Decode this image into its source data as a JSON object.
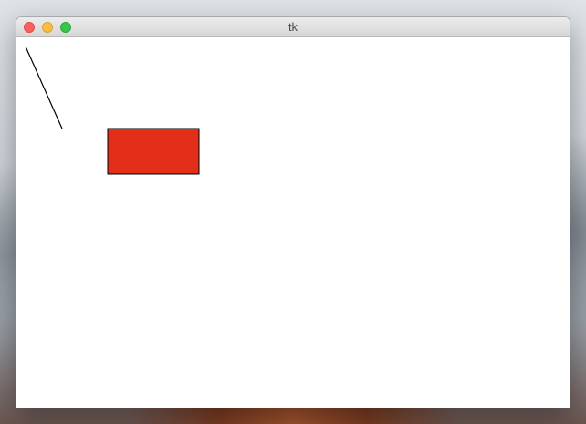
{
  "window": {
    "title": "tk"
  },
  "titlebar": {
    "buttons": [
      {
        "name": "close",
        "color": "#fc605c"
      },
      {
        "name": "minimize",
        "color": "#fdbc40"
      },
      {
        "name": "zoom",
        "color": "#34c84a"
      }
    ]
  },
  "canvas": {
    "background": "#ffffff",
    "shapes": [
      {
        "kind": "line",
        "color": "#000000"
      },
      {
        "kind": "rectangle",
        "fill": "#e32e1a",
        "outline": "#000000"
      }
    ]
  }
}
